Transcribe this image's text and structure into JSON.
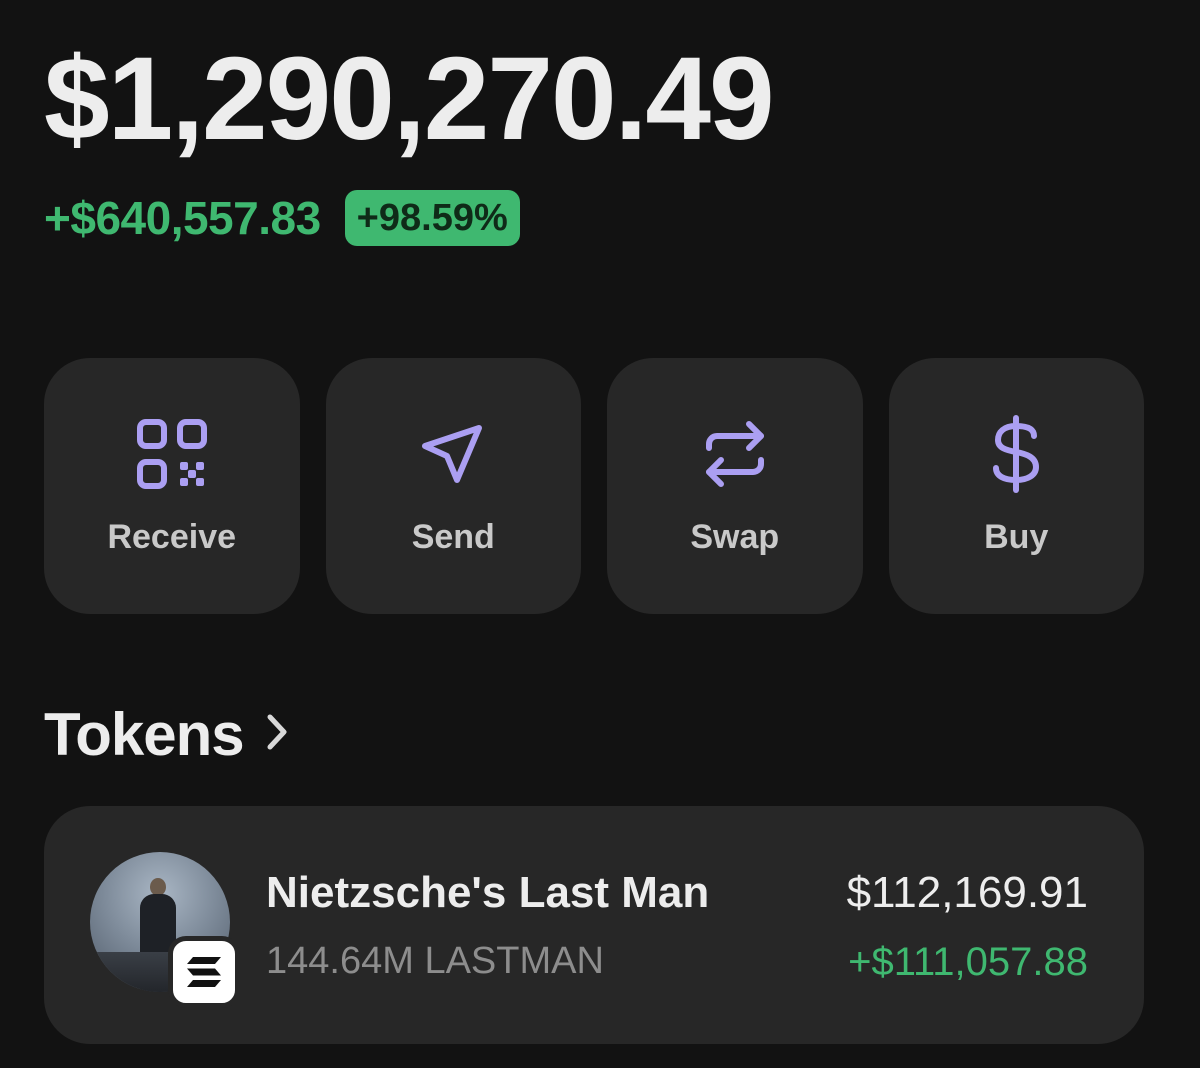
{
  "colors": {
    "gain": "#3fb870",
    "accent": "#ab9ff2",
    "card": "#272727",
    "background": "#121212"
  },
  "portfolio": {
    "balance": "$1,290,270.49",
    "change_amount": "+$640,557.83",
    "change_percent": "+98.59%"
  },
  "actions": [
    {
      "label": "Receive",
      "icon": "qr-code-icon"
    },
    {
      "label": "Send",
      "icon": "send-arrow-icon"
    },
    {
      "label": "Swap",
      "icon": "swap-arrows-icon"
    },
    {
      "label": "Buy",
      "icon": "dollar-sign-icon"
    }
  ],
  "tokens": {
    "heading": "Tokens",
    "items": [
      {
        "name": "Nietzsche's Last Man",
        "amount": "144.64M LASTMAN",
        "value": "$112,169.91",
        "pnl": "+$111,057.88",
        "chain_icon": "solana-icon"
      }
    ]
  }
}
